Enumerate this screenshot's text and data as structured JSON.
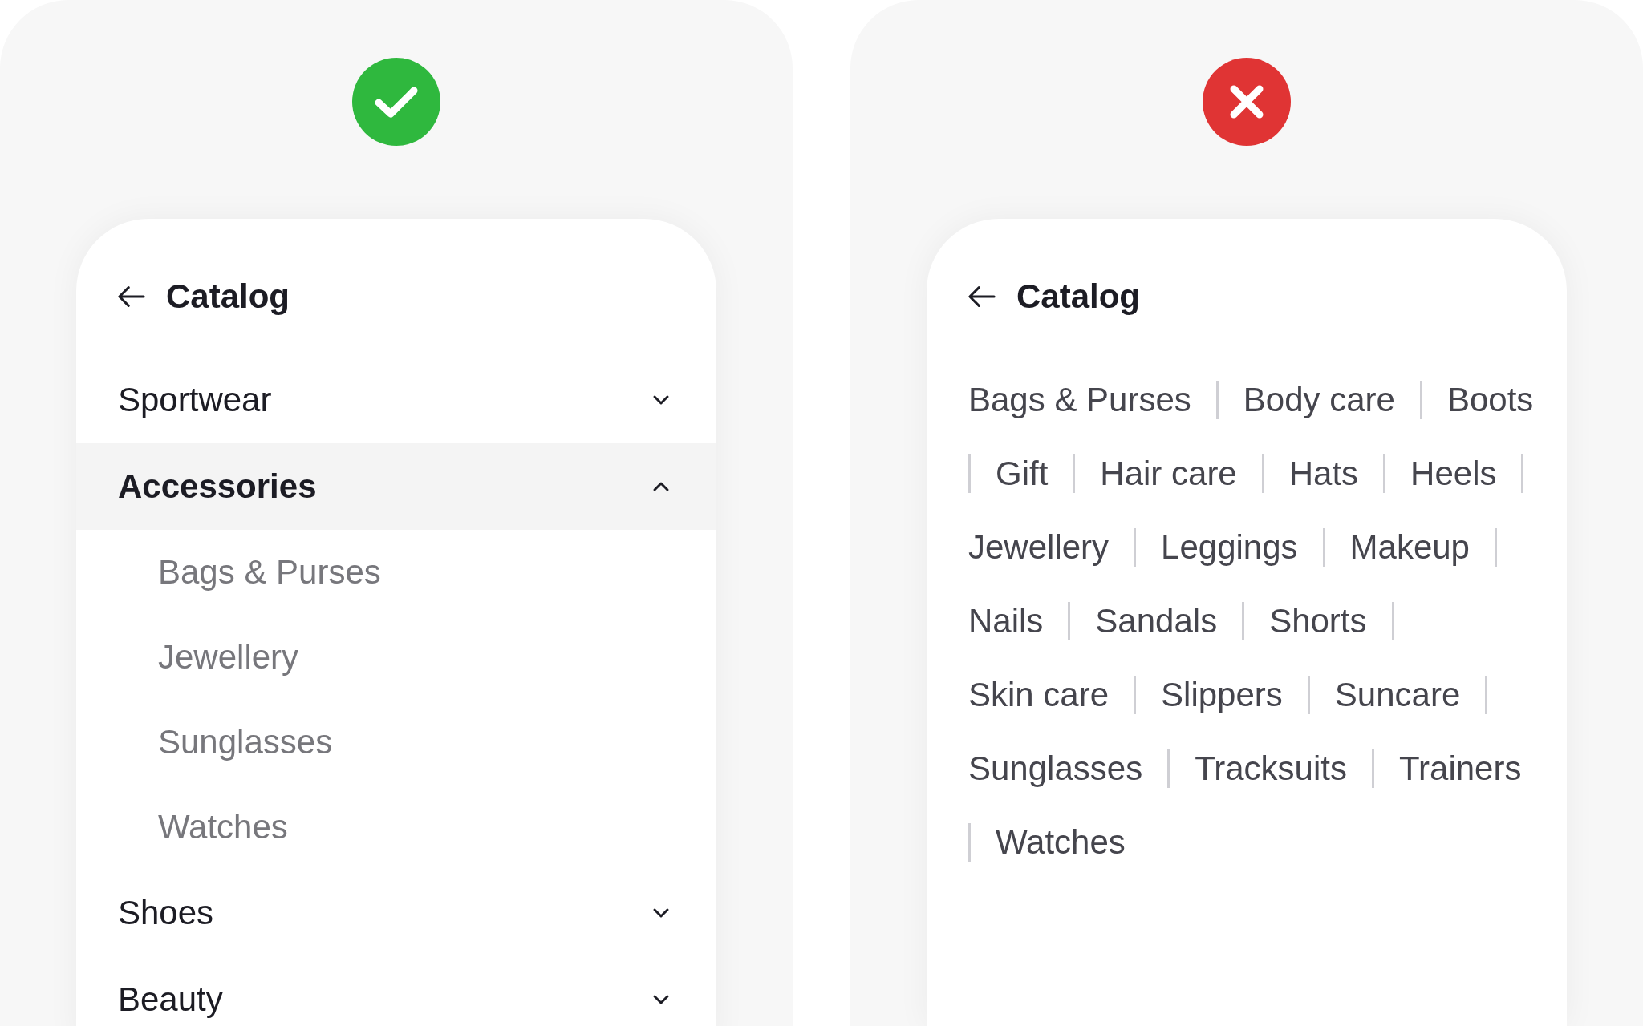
{
  "panels": [
    {
      "kind": "good",
      "screen": {
        "title": "Catalog",
        "kind": "accordion",
        "items": [
          {
            "label": "Sportwear",
            "expanded": false
          },
          {
            "label": "Accessories",
            "expanded": true,
            "children": [
              "Bags & Purses",
              "Jewellery",
              "Sunglasses",
              "Watches"
            ]
          },
          {
            "label": "Shoes",
            "expanded": false
          },
          {
            "label": "Beauty",
            "expanded": false
          }
        ]
      }
    },
    {
      "kind": "bad",
      "screen": {
        "title": "Catalog",
        "kind": "flat",
        "words": [
          "Bags & Purses",
          "Body care",
          "Boots",
          "Gift",
          "Hair care",
          "Hats",
          "Heels",
          "Jewellery",
          "Leggings",
          "Makeup",
          "Nails",
          "Sandals",
          "Shorts",
          "Skin care",
          "Slippers",
          "Suncare",
          "Sunglasses",
          "Tracksuits",
          "Trainers",
          "Watches"
        ]
      }
    }
  ]
}
